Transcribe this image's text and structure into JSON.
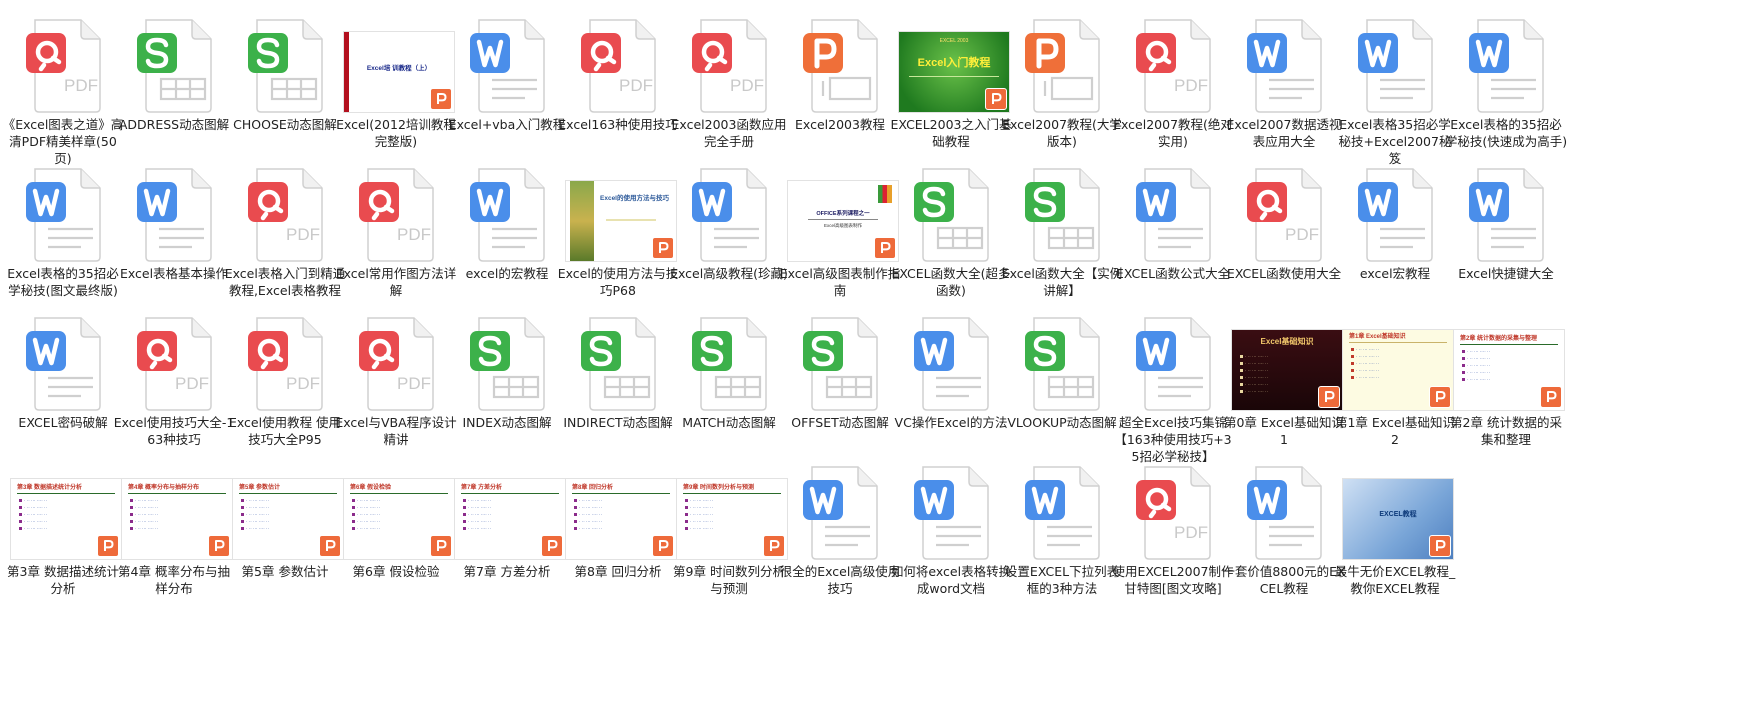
{
  "colors": {
    "pdf": "#e94b4f",
    "xls": "#3cb14a",
    "doc": "#4a8eea",
    "ppt": "#ef6f39",
    "slide_badge": "#ee6a3a"
  },
  "files": [
    {
      "name": "《Excel图表之道》高清PDF精美样章(50页)",
      "icon": "pdf-file-icon",
      "thumb": "pdf"
    },
    {
      "name": "ADDRESS动态图解",
      "icon": "spreadsheet-file-icon",
      "thumb": "xls"
    },
    {
      "name": "CHOOSE动态图解",
      "icon": "spreadsheet-file-icon",
      "thumb": "xls"
    },
    {
      "name": "Excel(2012培训教程完整版)",
      "icon": "presentation-thumbnail",
      "thumb": "slide",
      "slide": {
        "style": "redside",
        "title": "Excel培 训教程（上）"
      }
    },
    {
      "name": "Excel+vba入门教程",
      "icon": "word-file-icon",
      "thumb": "doc"
    },
    {
      "name": "Excel163种使用技巧",
      "icon": "pdf-file-icon",
      "thumb": "pdf"
    },
    {
      "name": "Excel2003函数应用完全手册",
      "icon": "pdf-file-icon",
      "thumb": "pdf"
    },
    {
      "name": "Excel2003教程",
      "icon": "presentation-file-icon",
      "thumb": "ppt"
    },
    {
      "name": "EXCEL2003之入门基础教程",
      "icon": "presentation-thumbnail",
      "thumb": "slide",
      "slide": {
        "style": "green",
        "title": "Excel入门教程",
        "sub": "EXCEL 2003"
      }
    },
    {
      "name": "Excel2007教程(大学版本)",
      "icon": "presentation-file-icon",
      "thumb": "ppt"
    },
    {
      "name": "Excel2007教程(绝对实用)",
      "icon": "pdf-file-icon",
      "thumb": "pdf"
    },
    {
      "name": "Excel2007数据透视表应用大全",
      "icon": "word-file-icon",
      "thumb": "doc"
    },
    {
      "name": "Excel表格35招必学秘技+Excel2007秘笈",
      "icon": "word-file-icon",
      "thumb": "doc"
    },
    {
      "name": "Excel表格的35招必学秘技(快速成为高手)",
      "icon": "word-file-icon",
      "thumb": "doc"
    },
    {
      "name": "Excel表格的35招必学秘技(图文最终版)",
      "icon": "word-file-icon",
      "thumb": "doc"
    },
    {
      "name": "Excel表格基本操作",
      "icon": "word-file-icon",
      "thumb": "doc"
    },
    {
      "name": "Excel表格入门到精通教程,Excel表格教程",
      "icon": "pdf-file-icon",
      "thumb": "pdf"
    },
    {
      "name": "Excel常用作图方法详解",
      "icon": "pdf-file-icon",
      "thumb": "pdf"
    },
    {
      "name": "excel的宏教程",
      "icon": "word-file-icon",
      "thumb": "doc"
    },
    {
      "name": "Excel的使用方法与技巧P68",
      "icon": "presentation-thumbnail",
      "thumb": "slide",
      "slide": {
        "style": "leaf",
        "title": "Excel的使用方法与技巧"
      }
    },
    {
      "name": "Excel高级教程(珍藏)",
      "icon": "word-file-icon",
      "thumb": "doc"
    },
    {
      "name": "Excel高级图表制作指南",
      "icon": "presentation-thumbnail",
      "thumb": "slide",
      "slide": {
        "style": "office",
        "title": "OFFICE系列课程之一",
        "sub": "Excel高级图表制作"
      }
    },
    {
      "name": "EXCEL函数大全(超多函数)",
      "icon": "spreadsheet-file-icon",
      "thumb": "xls"
    },
    {
      "name": "Excel函数大全【实例讲解】",
      "icon": "spreadsheet-file-icon",
      "thumb": "xls"
    },
    {
      "name": "EXCEL函数公式大全",
      "icon": "word-file-icon",
      "thumb": "doc"
    },
    {
      "name": "EXCEL函数使用大全",
      "icon": "pdf-file-icon",
      "thumb": "pdf"
    },
    {
      "name": "excel宏教程",
      "icon": "word-file-icon",
      "thumb": "doc"
    },
    {
      "name": "Excel快捷键大全",
      "icon": "word-file-icon",
      "thumb": "doc"
    },
    {
      "name": "EXCEL密码破解",
      "icon": "word-file-icon",
      "thumb": "doc"
    },
    {
      "name": "Excel使用技巧大全-163种技巧",
      "icon": "pdf-file-icon",
      "thumb": "pdf"
    },
    {
      "name": "Excel使用教程 使用技巧大全P95",
      "icon": "pdf-file-icon",
      "thumb": "pdf"
    },
    {
      "name": "Excel与VBA程序设计精讲",
      "icon": "pdf-file-icon",
      "thumb": "pdf"
    },
    {
      "name": "INDEX动态图解",
      "icon": "spreadsheet-file-icon",
      "thumb": "xls"
    },
    {
      "name": "INDIRECT动态图解",
      "icon": "spreadsheet-file-icon",
      "thumb": "xls"
    },
    {
      "name": "MATCH动态图解",
      "icon": "spreadsheet-file-icon",
      "thumb": "xls"
    },
    {
      "name": "OFFSET动态图解",
      "icon": "spreadsheet-file-icon",
      "thumb": "xls"
    },
    {
      "name": "VC操作Excel的方法",
      "icon": "word-file-icon",
      "thumb": "doc"
    },
    {
      "name": "VLOOKUP动态图解",
      "icon": "spreadsheet-file-icon",
      "thumb": "xls"
    },
    {
      "name": "超全Excel技巧集锦【163种使用技巧+35招必学秘技】",
      "icon": "word-file-icon",
      "thumb": "doc"
    },
    {
      "name": "第0章 Excel基础知识1",
      "icon": "presentation-thumbnail",
      "thumb": "slide",
      "slide": {
        "style": "dark",
        "title": "Excel基础知识"
      }
    },
    {
      "name": "第1章 Excel基础知识2",
      "icon": "presentation-thumbnail",
      "thumb": "slide",
      "slide": {
        "style": "cream",
        "title": "第1章 Excel基础知识"
      }
    },
    {
      "name": "第2章 统计数据的采集和整理",
      "icon": "presentation-thumbnail",
      "thumb": "slide",
      "slide": {
        "style": "light",
        "title": "第2章 统计数据的采集与整理"
      }
    },
    {
      "name": "第3章 数据描述统计分析",
      "icon": "presentation-thumbnail",
      "thumb": "slide",
      "slide": {
        "style": "light",
        "title": "第3章 数据描述统计分析"
      }
    },
    {
      "name": "第4章 概率分布与抽样分布",
      "icon": "presentation-thumbnail",
      "thumb": "slide",
      "slide": {
        "style": "light",
        "title": "第4章 概率分布与抽样分布"
      }
    },
    {
      "name": "第5章 参数估计",
      "icon": "presentation-thumbnail",
      "thumb": "slide",
      "slide": {
        "style": "light",
        "title": "第5章 参数估计"
      }
    },
    {
      "name": "第6章 假设检验",
      "icon": "presentation-thumbnail",
      "thumb": "slide",
      "slide": {
        "style": "light",
        "title": "第6章 假设检验"
      }
    },
    {
      "name": "第7章 方差分析",
      "icon": "presentation-thumbnail",
      "thumb": "slide",
      "slide": {
        "style": "light",
        "title": "第7章 方差分析"
      }
    },
    {
      "name": "第8章 回归分析",
      "icon": "presentation-thumbnail",
      "thumb": "slide",
      "slide": {
        "style": "light",
        "title": "第8章 回归分析"
      }
    },
    {
      "name": "第9章 时间数列分析与预测",
      "icon": "presentation-thumbnail",
      "thumb": "slide",
      "slide": {
        "style": "light",
        "title": "第9章 时间数列分析与预测"
      }
    },
    {
      "name": "很全的Excel高级使用技巧",
      "icon": "word-file-icon",
      "thumb": "doc"
    },
    {
      "name": "如何将excel表格转换成word文档",
      "icon": "word-file-icon",
      "thumb": "doc"
    },
    {
      "name": "设置EXCEL下拉列表框的3种方法",
      "icon": "word-file-icon",
      "thumb": "doc"
    },
    {
      "name": "使用EXCEL2007制作甘特图[图文攻略]",
      "icon": "pdf-file-icon",
      "thumb": "pdf"
    },
    {
      "name": "一套价值8800元的EXCEL教程",
      "icon": "word-file-icon",
      "thumb": "doc"
    },
    {
      "name": "最牛无价EXCEL教程_教你EXCEL教程",
      "icon": "presentation-thumbnail",
      "thumb": "slide",
      "slide": {
        "style": "blue",
        "title": "EXCEL教程"
      }
    }
  ]
}
